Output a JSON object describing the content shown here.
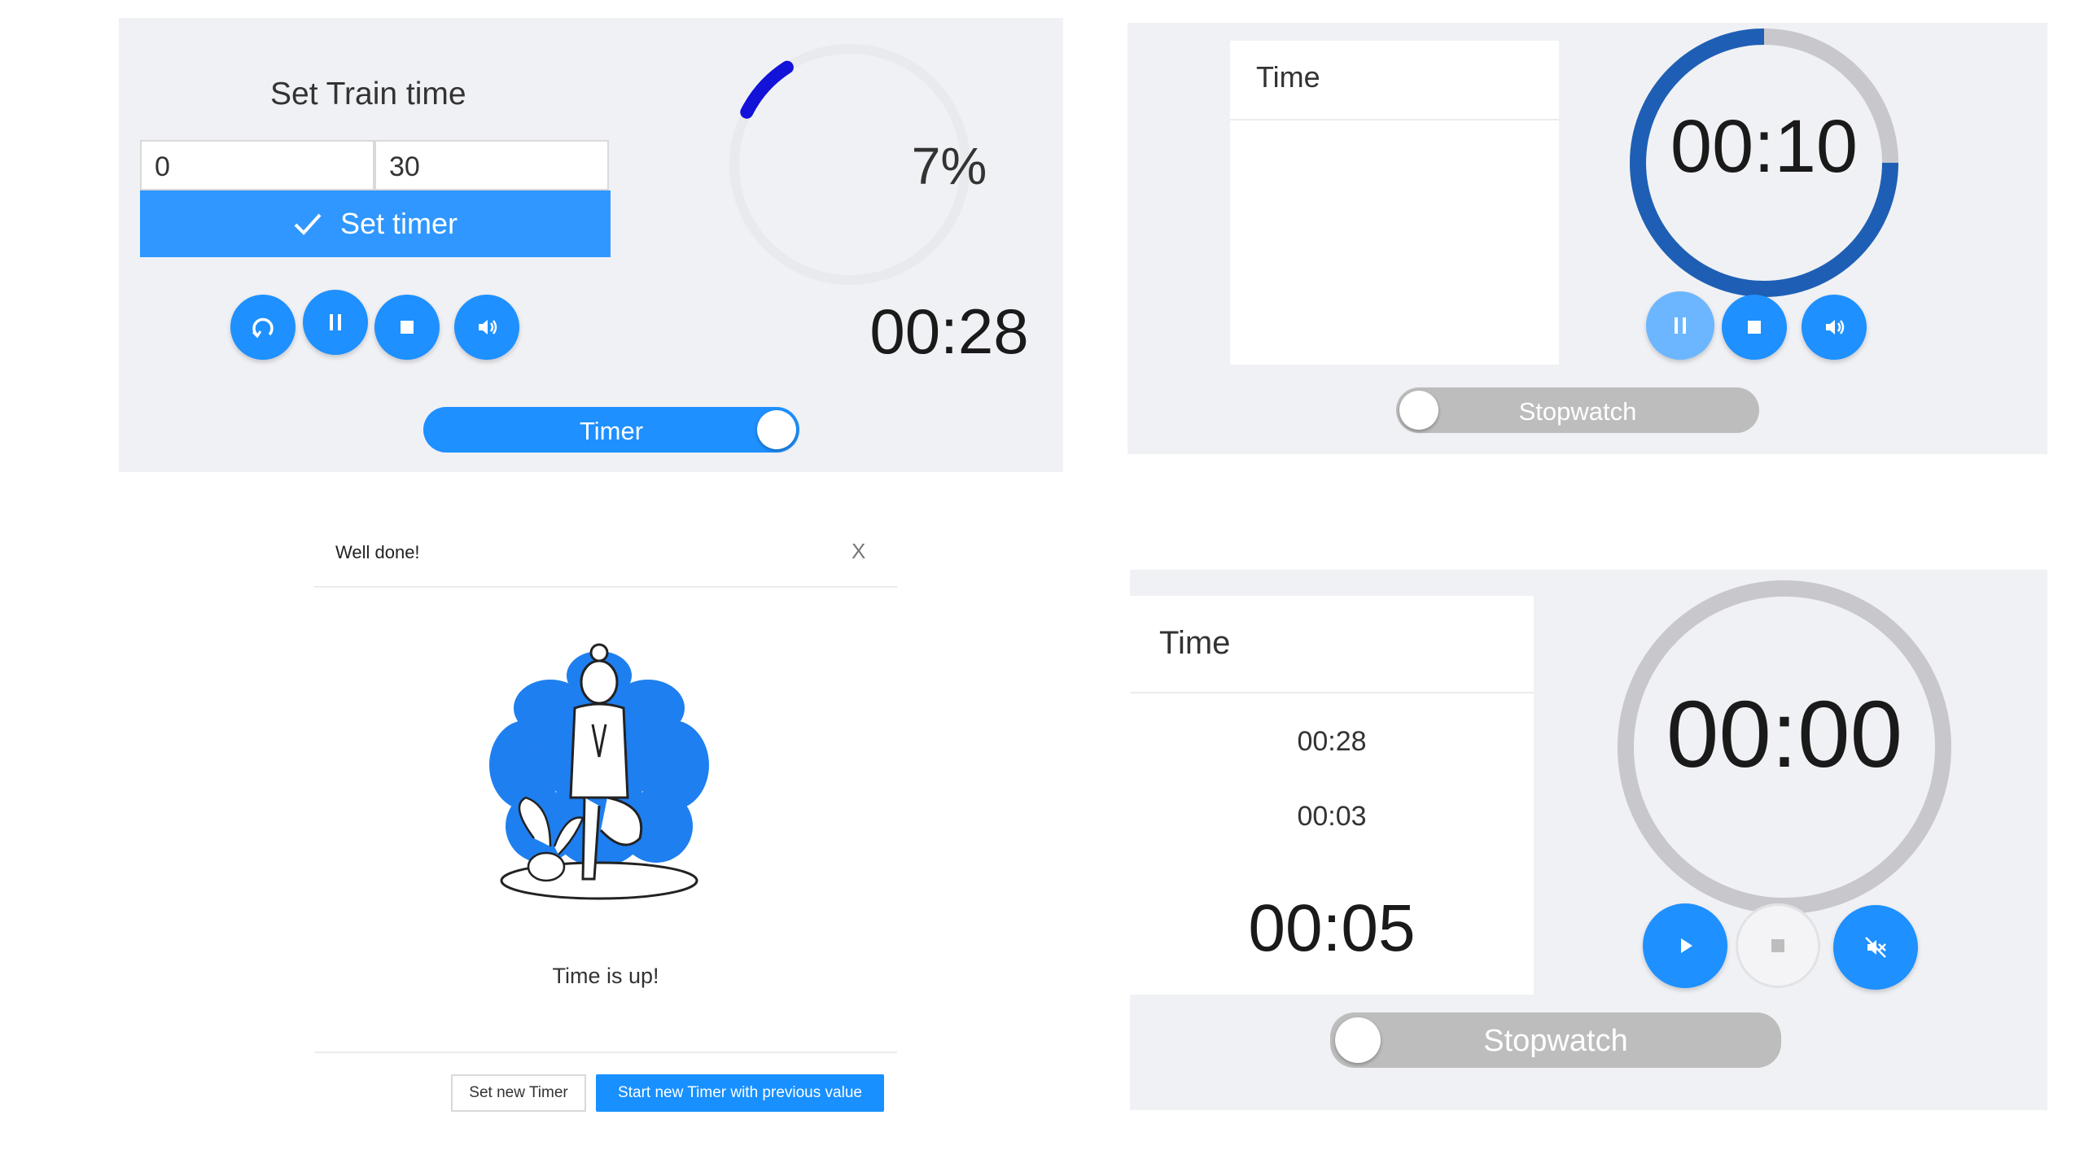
{
  "timer_panel": {
    "heading": "Set Train time",
    "minutes_value": "0",
    "seconds_value": "30",
    "set_button_label": "Set timer",
    "progress_label": "7%",
    "progress_fraction": 0.07,
    "time": "00:28",
    "mode_toggle_label": "Timer",
    "mode_toggle_on": true,
    "accent_color": "#1e90ff"
  },
  "stopwatch_running_panel": {
    "laps_header": "Time",
    "laps": [],
    "time": "00:10",
    "ring_color": "#1e5fb5",
    "mode_toggle_label": "Stopwatch",
    "mode_toggle_on": false
  },
  "modal": {
    "title": "Well done!",
    "close_label": "X",
    "message": "Time is up!",
    "secondary_button": "Set new Timer",
    "primary_button": "Start new Timer with previous value",
    "illustration": "meditation-illustration"
  },
  "stopwatch_stopped_panel": {
    "laps_header": "Time",
    "laps": [
      "00:28",
      "00:03"
    ],
    "current_lap": "00:05",
    "time": "00:00",
    "mode_toggle_label": "Stopwatch",
    "mode_toggle_on": false
  }
}
